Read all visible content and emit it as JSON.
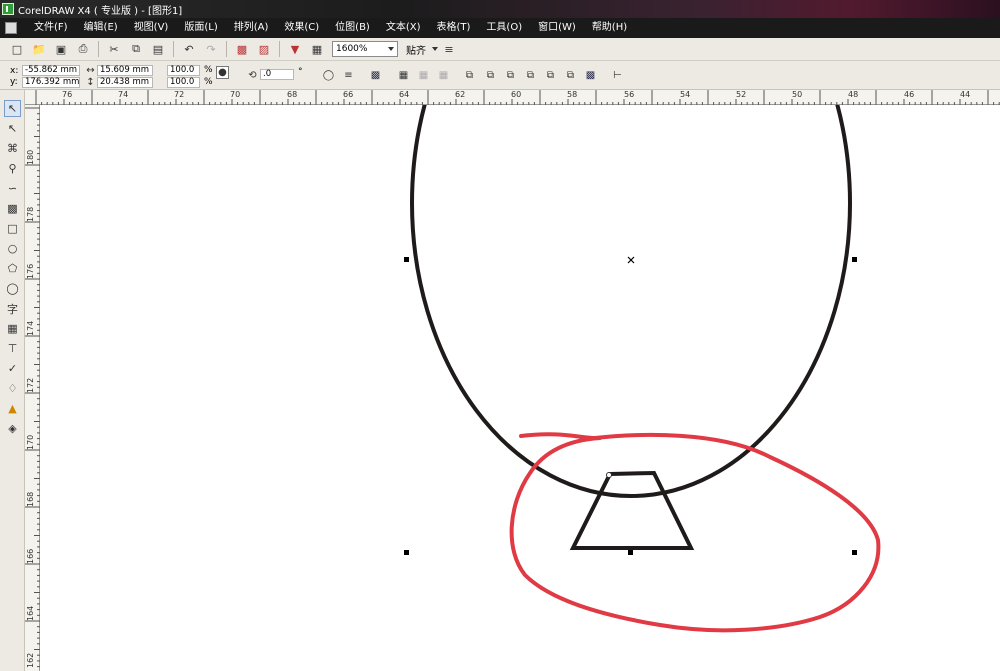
{
  "title": "CorelDRAW X4 ( 专业版 ) - [图形1]",
  "menu": [
    "文件(F)",
    "编辑(E)",
    "视图(V)",
    "版面(L)",
    "排列(A)",
    "效果(C)",
    "位图(B)",
    "文本(X)",
    "表格(T)",
    "工具(O)",
    "窗口(W)",
    "帮助(H)"
  ],
  "toolbar": {
    "zoom": "1600%",
    "snap_label": "贴齐"
  },
  "properties": {
    "x_label": "x:",
    "x_value": "-55.862 mm",
    "y_label": "y:",
    "y_value": "176.392 mm",
    "width_value": "15.609 mm",
    "height_value": "20.438 mm",
    "scale_x": "100.0",
    "scale_y": "100.0",
    "percent": "%",
    "rotation": ".0",
    "degree": "°"
  },
  "ruler": {
    "top": [
      "76",
      "74",
      "72",
      "70",
      "68",
      "66",
      "64",
      "62",
      "60",
      "58",
      "56",
      "54",
      "52",
      "50",
      "48",
      "46",
      "44"
    ],
    "left": [
      "180",
      "178",
      "176",
      "174",
      "172",
      "170",
      "168",
      "166",
      "164",
      "162"
    ]
  },
  "colors": {
    "shape_stroke": "#1e1b1a",
    "annotation": "#e03a44",
    "toolbar_bg": "#eceae3",
    "menubar_bg": "#1a1a1a"
  }
}
